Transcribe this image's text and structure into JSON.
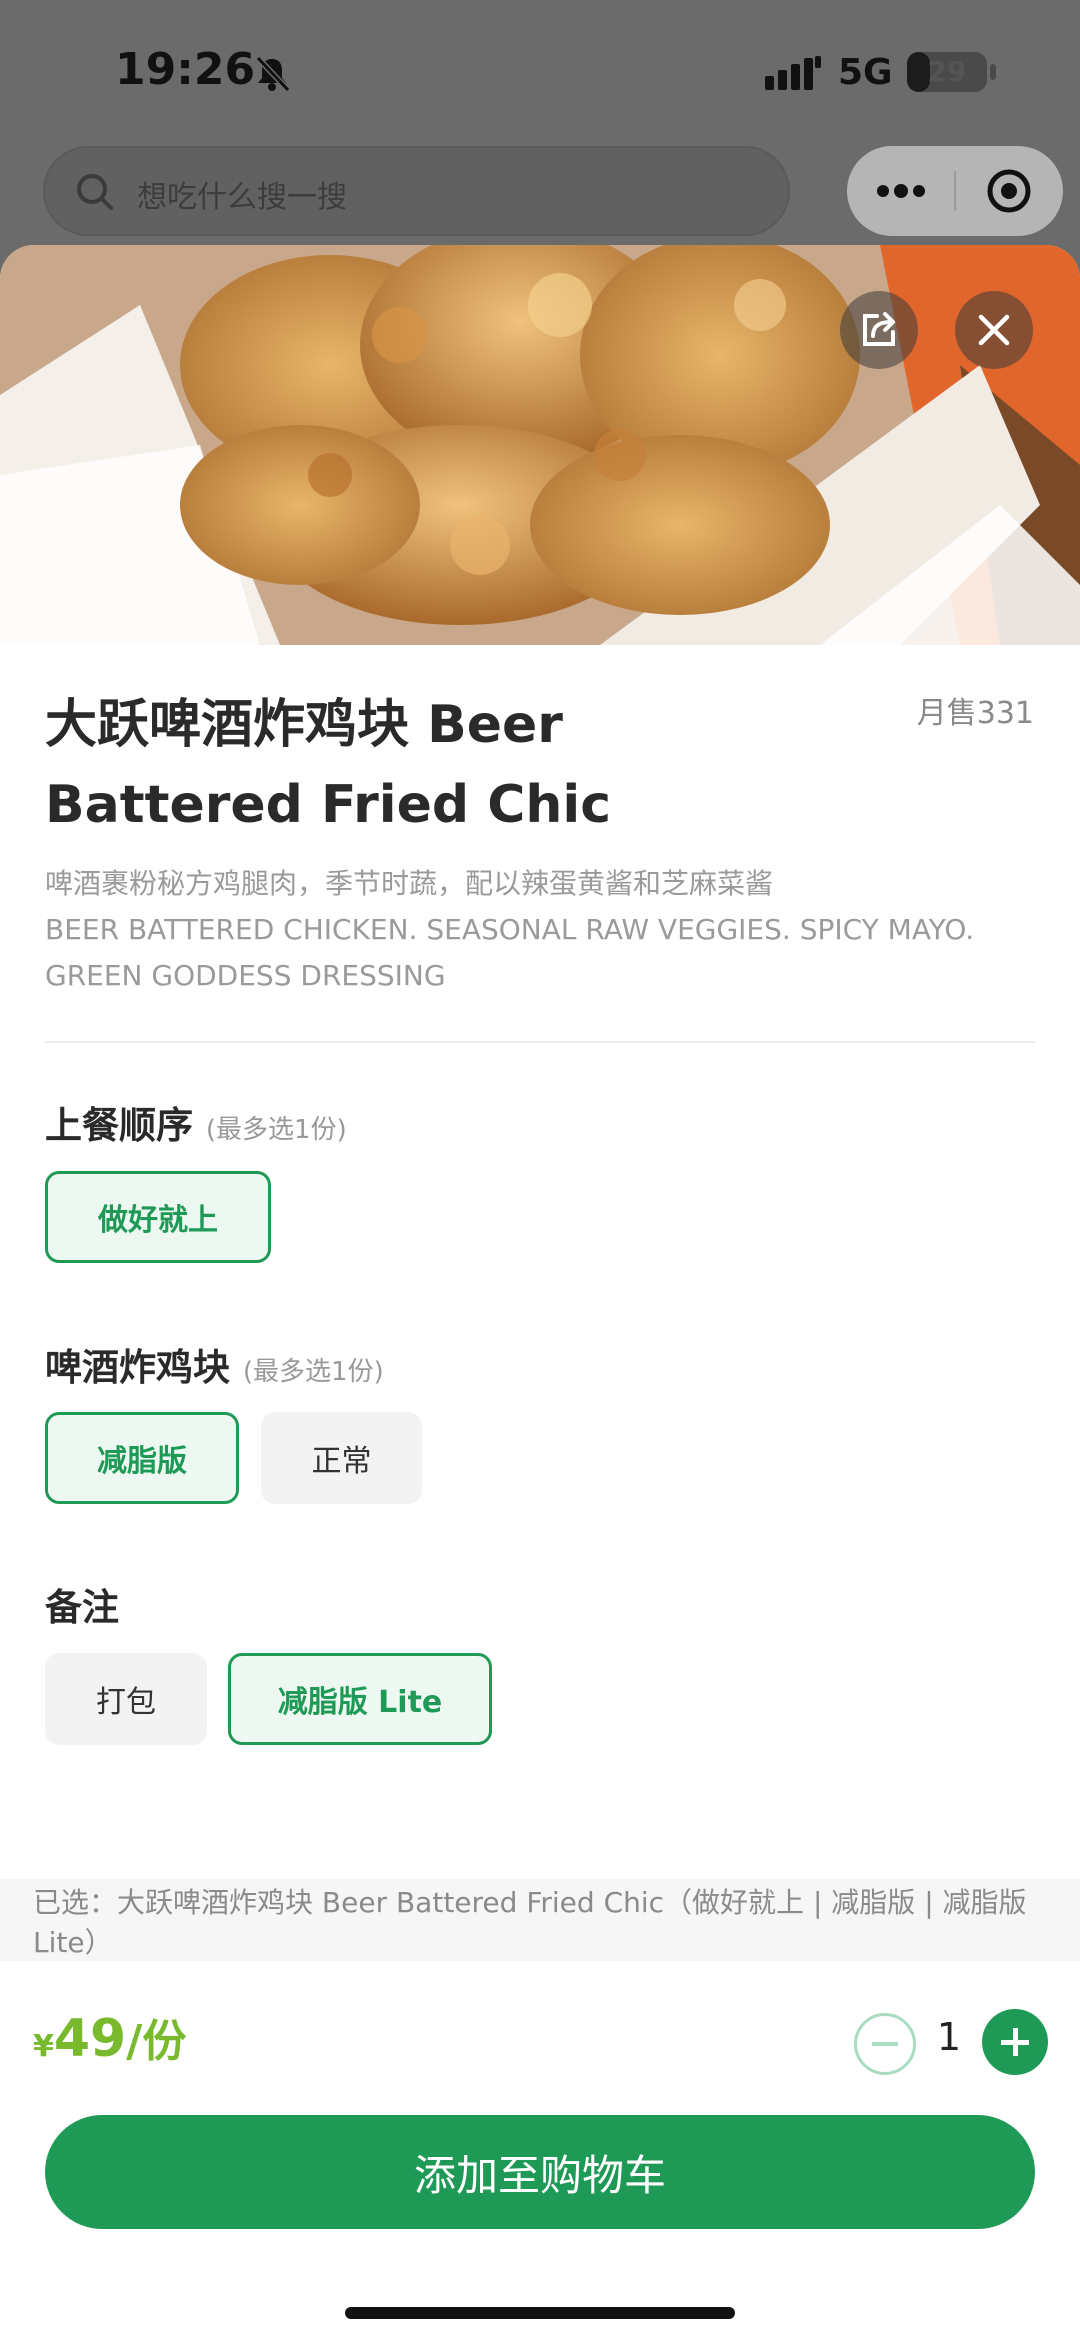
{
  "status_bar": {
    "time": "19:26",
    "network": "5G",
    "battery_level": "29",
    "battery_fraction": 0.29,
    "icons": [
      "bell-off-icon",
      "signal-icon",
      "battery-icon"
    ]
  },
  "search": {
    "placeholder": "想吃什么搜一搜",
    "icon": "search-icon"
  },
  "capsule": {
    "icons": [
      "more-icon",
      "target-icon"
    ]
  },
  "hero": {
    "icons": [
      "share-icon",
      "close-icon"
    ]
  },
  "dish": {
    "title": "大跃啤酒炸鸡块 Beer Battered Fried Chic",
    "monthly_sales": "月售331",
    "desc_cn": "啤酒裹粉秘方鸡腿肉，季节时蔬，配以辣蛋黄酱和芝麻菜酱",
    "desc_en": "BEER BATTERED CHICKEN. SEASONAL RAW VEGGIES. SPICY MAYO. GREEN GODDESS DRESSING"
  },
  "groups": [
    {
      "title": "上餐顺序",
      "hint": "(最多选1份)",
      "options": [
        {
          "label": "做好就上",
          "selected": true
        }
      ]
    },
    {
      "title": "啤酒炸鸡块",
      "hint": "(最多选1份)",
      "options": [
        {
          "label": "减脂版",
          "selected": true
        },
        {
          "label": "正常",
          "selected": false
        }
      ]
    },
    {
      "title": "备注",
      "hint": "",
      "options": [
        {
          "label": "打包",
          "selected": false
        },
        {
          "label": "减脂版 Lite",
          "selected": true
        }
      ]
    }
  ],
  "selection_summary": "已选：大跃啤酒炸鸡块 Beer Battered Fried Chic（做好就上 | 减脂版 | 减脂版 Lite）",
  "price": {
    "currency": "¥",
    "amount": "49",
    "unit": "/份"
  },
  "quantity": "1",
  "add_to_cart_label": "添加至购物车",
  "colors": {
    "accent_green": "#1f9a56",
    "price_green": "#78b92e",
    "selected_bg": "#eef8f2"
  }
}
